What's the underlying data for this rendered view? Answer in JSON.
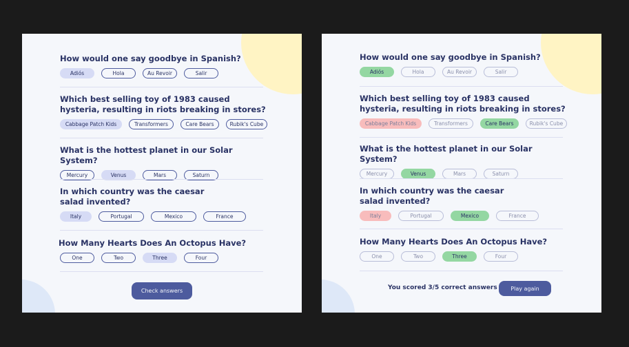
{
  "left": {
    "questions": [
      {
        "title": "How would one say goodbye in Spanish?",
        "options": [
          "Adiós",
          "Hola",
          "Au Revoir",
          "Salir"
        ]
      },
      {
        "title": "Which best selling toy of 1983 caused hysteria, resulting in riots breaking in stores?",
        "options": [
          "Cabbage Patch Kids",
          "Transformers",
          "Care Bears",
          "Rubik's Cube"
        ]
      },
      {
        "title": "What is the hottest planet in our Solar System?",
        "options": [
          "Mercury",
          "Venus",
          "Mars",
          "Saturn"
        ]
      },
      {
        "title": "In which country was the caesar salad invented?",
        "options": [
          "Italy",
          "Portugal",
          "Mexico",
          "France"
        ]
      },
      {
        "title": "How Many Hearts Does An Octopus Have?",
        "options": [
          "One",
          "Two",
          "Three",
          "Four"
        ]
      }
    ],
    "check_button": "Check answers"
  },
  "right": {
    "questions": [
      {
        "title": "How would one say goodbye in Spanish?",
        "options": [
          "Adiós",
          "Hola",
          "Au Revoir",
          "Salir"
        ]
      },
      {
        "title": "Which best selling toy of 1983 caused hysteria, resulting in riots breaking in stores?",
        "options": [
          "Cabbage Patch Kids",
          "Transformers",
          "Care Bears",
          "Rubik's Cube"
        ]
      },
      {
        "title": "What is the hottest planet in our Solar System?",
        "options": [
          "Mercury",
          "Venus",
          "Mars",
          "Saturn"
        ]
      },
      {
        "title": "In which country was the caesar salad invented?",
        "options": [
          "Italy",
          "Portugal",
          "Mexico",
          "France"
        ]
      },
      {
        "title": "How Many Hearts Does An Octopus Have?",
        "options": [
          "One",
          "Two",
          "Three",
          "Four"
        ]
      }
    ],
    "score_text": "You scored 3/5 correct answers",
    "play_again_button": "Play again"
  },
  "colors": {
    "background": "#1b1b1b",
    "panel": "#f5f7fb",
    "text": "#293264",
    "button": "#4d5b9e",
    "selected": "#d6dbf5",
    "correct": "#94d7a2",
    "wrong": "#f8bcbc",
    "blob_yellow": "#fff4c4",
    "blob_blue": "#dee8f8"
  }
}
